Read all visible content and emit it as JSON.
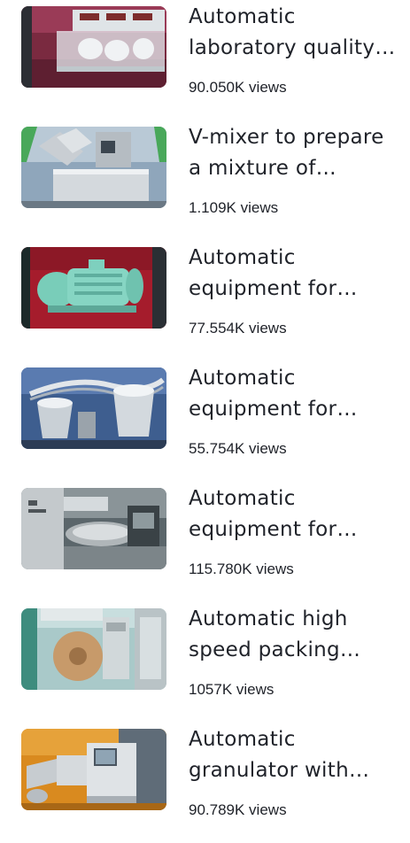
{
  "videos": [
    {
      "title": "Automatic laboratory quality control equipment",
      "views": "90.050K views",
      "thumb_icon": "lab-quality-tester-image",
      "colors": {
        "bg": "#8a2f48",
        "accent": "#c9d6dc",
        "machine": "#e4e9ec"
      }
    },
    {
      "title": "V-mixer to prepare a mixture of powders",
      "views": "1.109K views",
      "thumb_icon": "v-mixer-image",
      "colors": {
        "bg": "#6d8aa6",
        "accent": "#49a85a",
        "machine": "#c7ccd2"
      }
    },
    {
      "title": "Automatic equipment for pharmaceutical production",
      "views": "77.554K views",
      "thumb_icon": "green-motor-pump-image",
      "colors": {
        "bg": "#b01e2e",
        "accent": "#6ec9b5",
        "machine": "#7fd3c2"
      }
    },
    {
      "title": "Automatic equipment for pharmaceutical production",
      "views": "55.754K views",
      "thumb_icon": "steel-vacuum-loader-image",
      "colors": {
        "bg": "#4e6fa0",
        "accent": "#d8dde3",
        "machine": "#b9c1c9"
      }
    },
    {
      "title": "Automatic equipment for pharmaceutical production",
      "views": "115.780K views",
      "thumb_icon": "tablet-press-image",
      "colors": {
        "bg": "#3e4a4f",
        "accent": "#b7bcc0",
        "machine": "#8e979b"
      }
    },
    {
      "title": "Automatic high speed packing machine",
      "views": "1057K views",
      "thumb_icon": "packing-machine-image",
      "colors": {
        "bg": "#9cc4c4",
        "accent": "#c99a6a",
        "machine": "#cfd6d8"
      }
    },
    {
      "title": "Automatic granulator with control panel",
      "views": "90.789K views",
      "thumb_icon": "granulator-image",
      "colors": {
        "bg": "#d88a1e",
        "accent": "#6e7c8a",
        "machine": "#d3d8dc"
      }
    }
  ]
}
